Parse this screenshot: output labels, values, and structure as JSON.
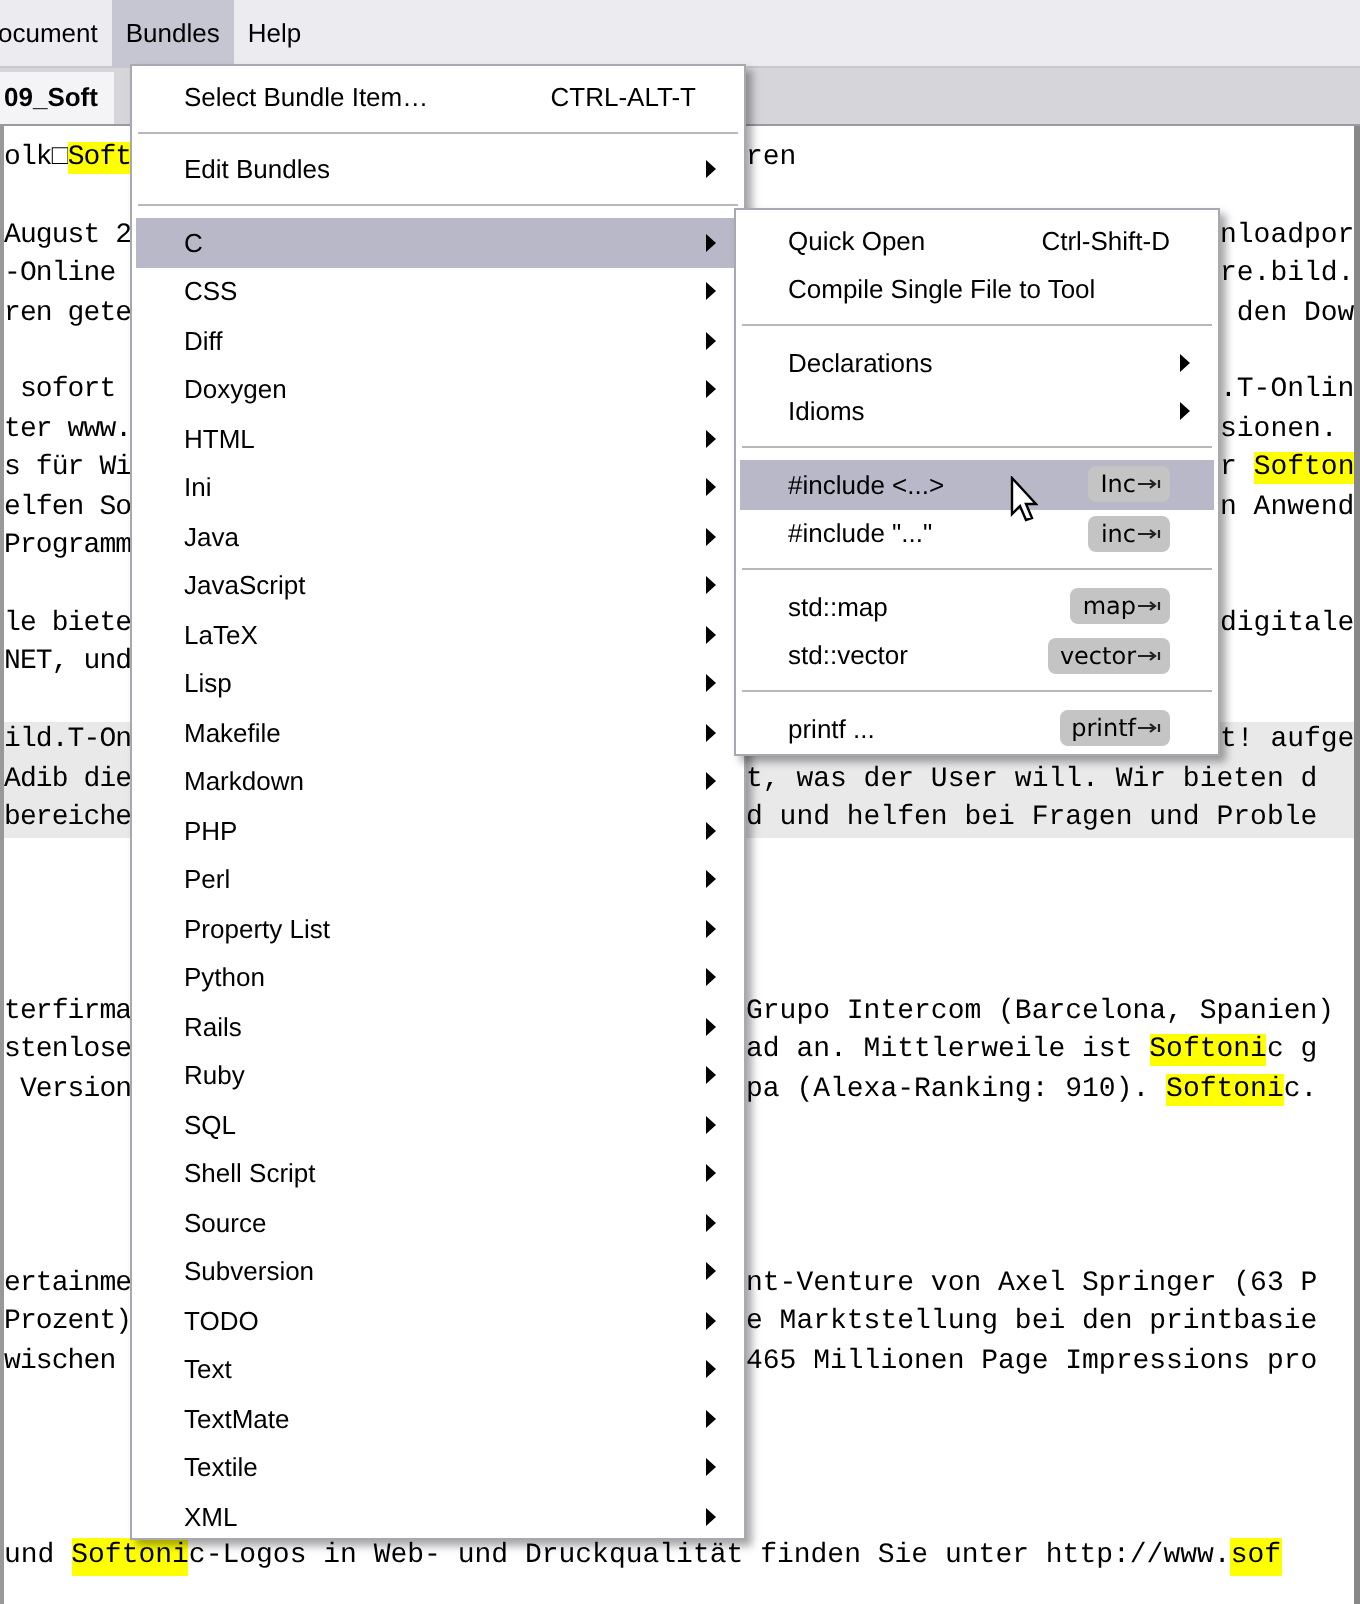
{
  "menubar": [
    {
      "label": "ocument",
      "selected": false
    },
    {
      "label": "Bundles",
      "selected": true
    },
    {
      "label": "Help",
      "selected": false
    }
  ],
  "tab": {
    "title": "09_Soft"
  },
  "editor": {
    "lines": [
      {
        "kind": "wide",
        "shaded": false,
        "left": [
          {
            "text": "olk□",
            "highlight": false
          },
          {
            "text": "Soft",
            "highlight": true
          }
        ],
        "right": [
          {
            "text": "ren",
            "highlight": false
          }
        ]
      },
      {
        "kind": "blank"
      },
      {
        "kind": "narrow",
        "shaded": false,
        "left": [
          {
            "text": "August 2",
            "highlight": false
          }
        ],
        "right": [
          {
            "text": "nloadpor",
            "highlight": false
          }
        ]
      },
      {
        "kind": "narrow",
        "shaded": false,
        "left": [
          {
            "text": "-Online",
            "highlight": false
          }
        ],
        "right": [
          {
            "text": "re.bild.",
            "highlight": false
          }
        ]
      },
      {
        "kind": "narrow",
        "shaded": false,
        "left": [
          {
            "text": "ren gete",
            "highlight": false
          }
        ],
        "right": [
          {
            "text": " den Dow",
            "highlight": false
          }
        ]
      },
      {
        "kind": "blank"
      },
      {
        "kind": "narrow",
        "shaded": false,
        "left": [
          {
            "text": " sofort",
            "highlight": false
          }
        ],
        "right": [
          {
            "text": ".T-Onlin",
            "highlight": false
          }
        ]
      },
      {
        "kind": "narrow",
        "shaded": false,
        "left": [
          {
            "text": "ter www.",
            "highlight": false
          }
        ],
        "right": [
          {
            "text": "sionen.",
            "highlight": false
          }
        ]
      },
      {
        "kind": "narrow",
        "shaded": false,
        "left": [
          {
            "text": "s für Wi",
            "highlight": false
          }
        ],
        "right": [
          {
            "text": "r ",
            "highlight": false
          },
          {
            "text": "Softon",
            "highlight": true
          }
        ]
      },
      {
        "kind": "narrow",
        "shaded": false,
        "left": [
          {
            "text": "elfen So",
            "highlight": false
          }
        ],
        "right": [
          {
            "text": "n Anwend",
            "highlight": false
          }
        ]
      },
      {
        "kind": "narrow",
        "shaded": false,
        "left": [
          {
            "text": "Programm",
            "highlight": false
          }
        ]
      },
      {
        "kind": "blank"
      },
      {
        "kind": "narrow",
        "shaded": false,
        "left": [
          {
            "text": "le biete",
            "highlight": false
          }
        ],
        "right": [
          {
            "text": "digitale",
            "highlight": false
          }
        ]
      },
      {
        "kind": "narrow",
        "shaded": false,
        "left": [
          {
            "text": "NET, und",
            "highlight": false
          }
        ]
      },
      {
        "kind": "blank"
      },
      {
        "kind": "narrow",
        "shaded": true,
        "left": [
          {
            "text": "ild.T-On",
            "highlight": false
          }
        ],
        "right": [
          {
            "text": "t! aufge",
            "highlight": false
          }
        ]
      },
      {
        "kind": "wide",
        "shaded": true,
        "left": [
          {
            "text": "Adib die",
            "highlight": false
          }
        ],
        "right": [
          {
            "text": "t, was der User will. Wir bieten d",
            "highlight": false
          }
        ]
      },
      {
        "kind": "wide",
        "shaded": true,
        "left": [
          {
            "text": "bereiche",
            "highlight": false
          }
        ],
        "right": [
          {
            "text": "d und helfen bei Fragen und Proble",
            "highlight": false
          }
        ]
      },
      {
        "kind": "blank"
      },
      {
        "kind": "blank"
      },
      {
        "kind": "blank"
      },
      {
        "kind": "blank"
      },
      {
        "kind": "wide",
        "shaded": false,
        "left": [
          {
            "text": "terfirma",
            "highlight": false
          }
        ],
        "right": [
          {
            "text": "Grupo Intercom (Barcelona, Spanien)",
            "highlight": false
          }
        ]
      },
      {
        "kind": "wide",
        "shaded": false,
        "left": [
          {
            "text": "stenlose",
            "highlight": false
          }
        ],
        "right": [
          {
            "text": "ad an. Mittlerweile ist ",
            "highlight": false
          },
          {
            "text": "Softoni",
            "highlight": true
          },
          {
            "text": "c g",
            "highlight": false
          }
        ]
      },
      {
        "kind": "wide",
        "shaded": false,
        "left": [
          {
            "text": " Version",
            "highlight": false
          }
        ],
        "right": [
          {
            "text": "pa (Alexa-Ranking: 910). ",
            "highlight": false
          },
          {
            "text": "Softoni",
            "highlight": true
          },
          {
            "text": "c.",
            "highlight": false
          }
        ]
      },
      {
        "kind": "blank"
      },
      {
        "kind": "blank"
      },
      {
        "kind": "blank"
      },
      {
        "kind": "blank"
      },
      {
        "kind": "wide",
        "shaded": false,
        "left": [
          {
            "text": "ertainme",
            "highlight": false
          }
        ],
        "right": [
          {
            "text": "nt-Venture von Axel Springer (63 P",
            "highlight": false
          }
        ]
      },
      {
        "kind": "wide",
        "shaded": false,
        "left": [
          {
            "text": "Prozent)",
            "highlight": false
          }
        ],
        "right": [
          {
            "text": "e Marktstellung bei den printbasie",
            "highlight": false
          }
        ]
      },
      {
        "kind": "wide",
        "shaded": false,
        "left": [
          {
            "text": "wischen",
            "highlight": false
          }
        ],
        "right": [
          {
            "text": "465 Millionen Page Impressions pro",
            "highlight": false
          }
        ]
      },
      {
        "kind": "blank"
      },
      {
        "kind": "blank"
      },
      {
        "kind": "blank"
      },
      {
        "kind": "blank"
      },
      {
        "kind": "full",
        "shaded": false,
        "left": [
          {
            "text": "und ",
            "highlight": false
          },
          {
            "text": "Softoni",
            "highlight": true
          },
          {
            "text": "c-Logos in Web- und Druckqualität finden Sie unter http://www.",
            "highlight": false
          },
          {
            "text": "sof",
            "highlight": true
          }
        ]
      }
    ]
  },
  "bundles_menu": {
    "items": [
      {
        "kind": "item",
        "label": "Select Bundle Item…",
        "shortcut": "CTRL-ALT-T",
        "submenu": false,
        "selected": false
      },
      {
        "kind": "separator"
      },
      {
        "kind": "item",
        "label": "Edit Bundles",
        "submenu": true,
        "selected": false
      },
      {
        "kind": "separator"
      },
      {
        "kind": "item",
        "label": "C",
        "submenu": true,
        "selected": true
      },
      {
        "kind": "item",
        "label": "CSS",
        "submenu": true,
        "selected": false
      },
      {
        "kind": "item",
        "label": "Diff",
        "submenu": true,
        "selected": false
      },
      {
        "kind": "item",
        "label": "Doxygen",
        "submenu": true,
        "selected": false
      },
      {
        "kind": "item",
        "label": "HTML",
        "submenu": true,
        "selected": false
      },
      {
        "kind": "item",
        "label": "Ini",
        "submenu": true,
        "selected": false
      },
      {
        "kind": "item",
        "label": "Java",
        "submenu": true,
        "selected": false
      },
      {
        "kind": "item",
        "label": "JavaScript",
        "submenu": true,
        "selected": false
      },
      {
        "kind": "item",
        "label": "LaTeX",
        "submenu": true,
        "selected": false
      },
      {
        "kind": "item",
        "label": "Lisp",
        "submenu": true,
        "selected": false
      },
      {
        "kind": "item",
        "label": "Makefile",
        "submenu": true,
        "selected": false
      },
      {
        "kind": "item",
        "label": "Markdown",
        "submenu": true,
        "selected": false
      },
      {
        "kind": "item",
        "label": "PHP",
        "submenu": true,
        "selected": false
      },
      {
        "kind": "item",
        "label": "Perl",
        "submenu": true,
        "selected": false
      },
      {
        "kind": "item",
        "label": "Property List",
        "submenu": true,
        "selected": false
      },
      {
        "kind": "item",
        "label": "Python",
        "submenu": true,
        "selected": false
      },
      {
        "kind": "item",
        "label": "Rails",
        "submenu": true,
        "selected": false
      },
      {
        "kind": "item",
        "label": "Ruby",
        "submenu": true,
        "selected": false
      },
      {
        "kind": "item",
        "label": "SQL",
        "submenu": true,
        "selected": false
      },
      {
        "kind": "item",
        "label": "Shell Script",
        "submenu": true,
        "selected": false
      },
      {
        "kind": "item",
        "label": "Source",
        "submenu": true,
        "selected": false
      },
      {
        "kind": "item",
        "label": "Subversion",
        "submenu": true,
        "selected": false
      },
      {
        "kind": "item",
        "label": "TODO",
        "submenu": true,
        "selected": false
      },
      {
        "kind": "item",
        "label": "Text",
        "submenu": true,
        "selected": false
      },
      {
        "kind": "item",
        "label": "TextMate",
        "submenu": true,
        "selected": false
      },
      {
        "kind": "item",
        "label": "Textile",
        "submenu": true,
        "selected": false
      },
      {
        "kind": "item",
        "label": "XML",
        "submenu": true,
        "selected": false
      }
    ]
  },
  "c_submenu": {
    "items": [
      {
        "kind": "item",
        "label": "Quick Open",
        "shortcut": "Ctrl-Shift-D",
        "submenu": false,
        "selected": false
      },
      {
        "kind": "item",
        "label": "Compile Single File to Tool",
        "submenu": false,
        "selected": false
      },
      {
        "kind": "separator"
      },
      {
        "kind": "item",
        "label": "Declarations",
        "submenu": true,
        "selected": false
      },
      {
        "kind": "item",
        "label": "Idioms",
        "submenu": true,
        "selected": false
      },
      {
        "kind": "separator"
      },
      {
        "kind": "item",
        "label": "#include <...>",
        "trigger": "Inc",
        "submenu": false,
        "selected": true
      },
      {
        "kind": "item",
        "label": "#include \"...\"",
        "trigger": "inc",
        "submenu": false,
        "selected": false
      },
      {
        "kind": "separator"
      },
      {
        "kind": "item",
        "label": "std::map",
        "trigger": "map",
        "submenu": false,
        "selected": false
      },
      {
        "kind": "item",
        "label": "std::vector",
        "trigger": "vector",
        "submenu": false,
        "selected": false
      },
      {
        "kind": "separator"
      },
      {
        "kind": "item",
        "label": "printf ...",
        "trigger": "printf",
        "submenu": false,
        "selected": false
      }
    ]
  }
}
